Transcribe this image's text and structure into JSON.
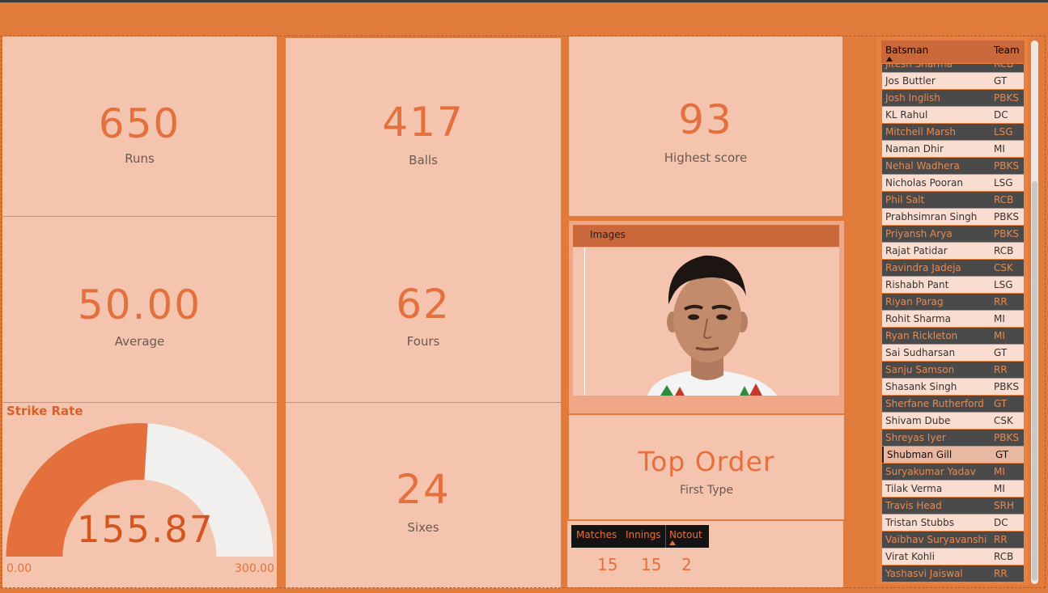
{
  "kpis": {
    "runs": {
      "value": "650",
      "label": "Runs"
    },
    "average": {
      "value": "50.00",
      "label": "Average"
    },
    "balls": {
      "value": "417",
      "label": "Balls"
    },
    "fours": {
      "value": "62",
      "label": "Fours"
    },
    "sixes": {
      "value": "24",
      "label": "Sixes"
    },
    "highest": {
      "value": "93",
      "label": "Highest score"
    }
  },
  "strike_rate": {
    "title": "Strike Rate",
    "value": "155.87",
    "min": "0.00",
    "max": "300.00",
    "fill_fraction": 0.5196
  },
  "images_panel": {
    "header": "Images"
  },
  "role": {
    "title": "Top Order",
    "subtitle": "First Type"
  },
  "stats_table": {
    "headers": [
      "Matches",
      "Innings",
      "Notout"
    ],
    "values": [
      "15",
      "15",
      "2"
    ]
  },
  "roster": {
    "headers": {
      "batsman": "Batsman",
      "team": "Team"
    },
    "rows": [
      {
        "name": "Jitesh Sharma",
        "team": "RCB"
      },
      {
        "name": "Jos Buttler",
        "team": "GT"
      },
      {
        "name": "Josh Inglish",
        "team": "PBKS"
      },
      {
        "name": "KL Rahul",
        "team": "DC"
      },
      {
        "name": "Mitchell Marsh",
        "team": "LSG"
      },
      {
        "name": "Naman Dhir",
        "team": "MI"
      },
      {
        "name": "Nehal Wadhera",
        "team": "PBKS"
      },
      {
        "name": "Nicholas Pooran",
        "team": "LSG"
      },
      {
        "name": "Phil Salt",
        "team": "RCB"
      },
      {
        "name": "Prabhsimran Singh",
        "team": "PBKS"
      },
      {
        "name": "Priyansh Arya",
        "team": "PBKS"
      },
      {
        "name": "Rajat Patidar",
        "team": "RCB"
      },
      {
        "name": "Ravindra Jadeja",
        "team": "CSK"
      },
      {
        "name": "Rishabh Pant",
        "team": "LSG"
      },
      {
        "name": "Riyan Parag",
        "team": "RR"
      },
      {
        "name": "Rohit Sharma",
        "team": "MI"
      },
      {
        "name": "Ryan Rickleton",
        "team": "MI"
      },
      {
        "name": "Sai Sudharsan",
        "team": "GT"
      },
      {
        "name": "Sanju Samson",
        "team": "RR"
      },
      {
        "name": "Shasank Singh",
        "team": "PBKS"
      },
      {
        "name": "Sherfane Rutherford",
        "team": "GT"
      },
      {
        "name": "Shivam Dube",
        "team": "CSK"
      },
      {
        "name": "Shreyas Iyer",
        "team": "PBKS"
      },
      {
        "name": "Shubman Gill",
        "team": "GT",
        "selected": true
      },
      {
        "name": "Suryakumar Yadav",
        "team": "MI"
      },
      {
        "name": "Tilak Verma",
        "team": "MI"
      },
      {
        "name": "Travis Head",
        "team": "SRH"
      },
      {
        "name": "Tristan Stubbs",
        "team": "DC"
      },
      {
        "name": "Vaibhav Suryavanshi",
        "team": "RR"
      },
      {
        "name": "Virat Kohli",
        "team": "RCB"
      },
      {
        "name": "Yashasvi Jaiswal",
        "team": "RR"
      }
    ]
  },
  "colors": {
    "background": "#E07B3C",
    "card": "#F4C4AE",
    "accent": "#E4703D",
    "gauge_fill": "#E4703D",
    "gauge_track": "#F2F0EF",
    "row_dark": "#4a4a4a",
    "row_light": "#F9DDD0"
  }
}
